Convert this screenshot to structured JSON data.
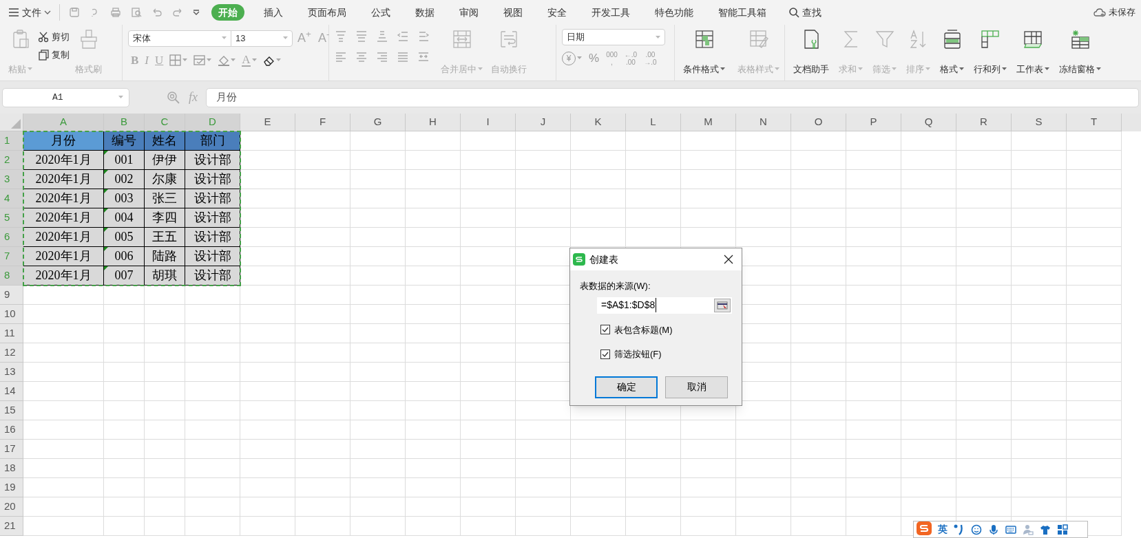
{
  "menu": {
    "file_label": "文件",
    "tabs": [
      {
        "label": "开始",
        "selected": true
      },
      {
        "label": "插入",
        "selected": false
      },
      {
        "label": "页面布局",
        "selected": false
      },
      {
        "label": "公式",
        "selected": false
      },
      {
        "label": "数据",
        "selected": false
      },
      {
        "label": "审阅",
        "selected": false
      },
      {
        "label": "视图",
        "selected": false
      },
      {
        "label": "安全",
        "selected": false
      },
      {
        "label": "开发工具",
        "selected": false
      },
      {
        "label": "特色功能",
        "selected": false
      },
      {
        "label": "智能工具箱",
        "selected": false
      }
    ],
    "search_label": "查找",
    "save_status": "未保存"
  },
  "ribbon": {
    "clipboard": [
      {
        "label": "粘贴",
        "kind": "large",
        "disabled": true,
        "dropdown": true
      },
      {
        "label": "剪切",
        "kind": "small",
        "disabled": false,
        "dropdown": false
      },
      {
        "label": "复制",
        "kind": "small",
        "disabled": false,
        "dropdown": false
      },
      {
        "label": "格式刷",
        "kind": "large",
        "disabled": true,
        "dropdown": false
      }
    ],
    "font_name": "宋体",
    "font_size": "13",
    "size_buttons": [
      "A$^{+}$",
      "A$^{-}$"
    ],
    "font_buttons": [
      {
        "glyph": "B",
        "dropdown": false
      },
      {
        "glyph": "I",
        "dropdown": false
      },
      {
        "glyph": "U",
        "dropdown": false
      },
      {
        "dropdown": true
      },
      {
        "dropdown": true
      },
      {
        "dropdown": true
      },
      {
        "glyph": "A",
        "dropdown": true
      },
      {
        "dropdown": true
      }
    ],
    "wrap_buttons": [
      {
        "label": "合并居中",
        "dropdown": true,
        "disabled": true
      },
      {
        "label": "自动换行",
        "dropdown": false,
        "disabled": true
      }
    ],
    "number_format": "日期",
    "number_buttons": [
      {
        "glyph": "¥",
        "dropdown": true
      },
      {
        "glyph": "%",
        "dropdown": false
      },
      {
        "lines": [
          "000",
          ","
        ]
      },
      {
        "lines": [
          "←.0",
          ".00"
        ]
      },
      {
        "lines": [
          ".00",
          "→.0"
        ]
      }
    ],
    "style_buttons": [
      {
        "label": "条件格式",
        "dropdown": true,
        "disabled": false
      },
      {
        "label": "表格样式",
        "dropdown": true,
        "disabled": true
      }
    ],
    "tool_buttons": [
      {
        "label": "文档助手",
        "dropdown": false,
        "disabled": false
      },
      {
        "label": "求和",
        "dropdown": true,
        "disabled": true
      },
      {
        "label": "筛选",
        "dropdown": true,
        "disabled": true
      },
      {
        "label": "排序",
        "dropdown": true,
        "disabled": true
      },
      {
        "label": "格式",
        "dropdown": true,
        "disabled": false
      },
      {
        "label": "行和列",
        "dropdown": true,
        "disabled": false
      },
      {
        "label": "工作表",
        "dropdown": true,
        "disabled": false
      },
      {
        "label": "冻结窗格",
        "dropdown": true,
        "disabled": false
      }
    ]
  },
  "formula_bar": {
    "name_box": "A1",
    "fx": "fx",
    "content": "月份"
  },
  "sheet": {
    "columns": [
      {
        "label": "A",
        "selected": true
      },
      {
        "label": "B",
        "selected": true
      },
      {
        "label": "C",
        "selected": true
      },
      {
        "label": "D",
        "selected": true
      },
      {
        "label": "E",
        "selected": false
      },
      {
        "label": "F",
        "selected": false
      },
      {
        "label": "G",
        "selected": false
      },
      {
        "label": "H",
        "selected": false
      },
      {
        "label": "I",
        "selected": false
      },
      {
        "label": "J",
        "selected": false
      },
      {
        "label": "K",
        "selected": false
      },
      {
        "label": "L",
        "selected": false
      },
      {
        "label": "M",
        "selected": false
      },
      {
        "label": "N",
        "selected": false
      },
      {
        "label": "O",
        "selected": false
      },
      {
        "label": "P",
        "selected": false
      },
      {
        "label": "Q",
        "selected": false
      },
      {
        "label": "R",
        "selected": false
      },
      {
        "label": "S",
        "selected": false
      },
      {
        "label": "T",
        "selected": false
      }
    ],
    "row_headers": [
      {
        "label": "1",
        "selected": true
      },
      {
        "label": "2",
        "selected": true
      },
      {
        "label": "3",
        "selected": true
      },
      {
        "label": "4",
        "selected": true
      },
      {
        "label": "5",
        "selected": true
      },
      {
        "label": "6",
        "selected": true
      },
      {
        "label": "7",
        "selected": true
      },
      {
        "label": "8",
        "selected": true
      },
      {
        "label": "9",
        "selected": false
      },
      {
        "label": "10",
        "selected": false
      },
      {
        "label": "11",
        "selected": false
      },
      {
        "label": "12",
        "selected": false
      },
      {
        "label": "13",
        "selected": false
      },
      {
        "label": "14",
        "selected": false
      },
      {
        "label": "15",
        "selected": false
      },
      {
        "label": "16",
        "selected": false
      },
      {
        "label": "17",
        "selected": false
      },
      {
        "label": "18",
        "selected": false
      },
      {
        "label": "19",
        "selected": false
      },
      {
        "label": "20",
        "selected": false
      },
      {
        "label": "21",
        "selected": false
      }
    ],
    "header_row": [
      "月份",
      "编号",
      "姓名",
      "部门"
    ],
    "rows": [
      {
        "cells": [
          "2020年1月",
          "001",
          "伊伊",
          "设计部"
        ],
        "number_as_text": true
      },
      {
        "cells": [
          "2020年1月",
          "002",
          "尔康",
          "设计部"
        ],
        "number_as_text": true
      },
      {
        "cells": [
          "2020年1月",
          "003",
          "张三",
          "设计部"
        ],
        "number_as_text": true
      },
      {
        "cells": [
          "2020年1月",
          "004",
          "李四",
          "设计部"
        ],
        "number_as_text": true
      },
      {
        "cells": [
          "2020年1月",
          "005",
          "王五",
          "设计部"
        ],
        "number_as_text": true
      },
      {
        "cells": [
          "2020年1月",
          "006",
          "陆路",
          "设计部"
        ],
        "number_as_text": true
      },
      {
        "cells": [
          "2020年1月",
          "007",
          "胡琪",
          "设计部"
        ],
        "number_as_text": true
      }
    ]
  },
  "dialog": {
    "title": "创建表",
    "source_label": "表数据的来源(W):",
    "source_value": "=$A$1:$D$8",
    "checkboxes": [
      {
        "label": "表包含标题(M)",
        "checked": true
      },
      {
        "label": "筛选按钮(F)",
        "checked": true
      }
    ],
    "buttons": [
      {
        "label": "确定",
        "default": true
      },
      {
        "label": "取消",
        "default": false
      }
    ]
  },
  "ime_bar": {
    "mode": "英"
  }
}
